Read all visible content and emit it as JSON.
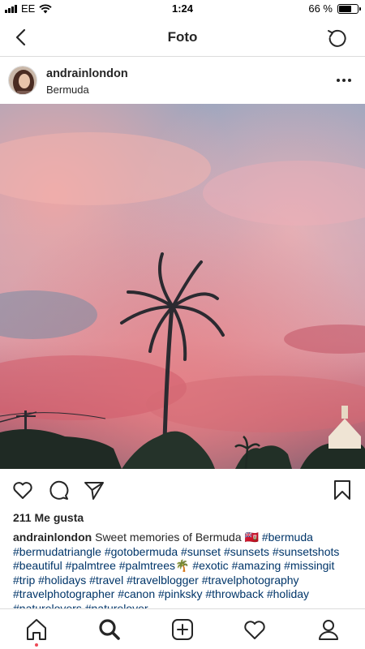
{
  "status_bar": {
    "carrier": "EE",
    "time": "1:24",
    "battery_text": "66 %",
    "battery_level": 0.66
  },
  "nav": {
    "title": "Foto",
    "back_icon": "chevron-left-icon",
    "refresh_icon": "refresh-icon"
  },
  "post": {
    "username": "andrainlondon",
    "location": "Bermuda",
    "more_icon": "more-horizontal-icon",
    "likes": "211 Me gusta",
    "caption": {
      "username": "andrainlondon",
      "text": "Sweet memories of Bermuda 🇧🇲",
      "tags_line1": "#bermuda",
      "tags_rest": "#bermudatriangle #gotobermuda #sunset #sunsets #sunsetshots #beautiful #palmtree #palmtrees🌴 #exotic #amazing #missingit #trip #holidays #travel #travelblogger #travelphotography #travelphotographer #canon #pinksky #throwback #holiday #naturelovers #naturelover"
    }
  },
  "actions": {
    "like_icon": "heart-icon",
    "comment_icon": "comment-icon",
    "share_icon": "send-icon",
    "save_icon": "bookmark-icon"
  },
  "tabbar": {
    "items": [
      "home-icon",
      "search-icon",
      "add-post-icon",
      "activity-heart-icon",
      "profile-icon"
    ],
    "notification_color": "#ed4956"
  },
  "colors": {
    "text": "#262626",
    "hashtag": "#003569",
    "divider": "#dbdbdb"
  }
}
